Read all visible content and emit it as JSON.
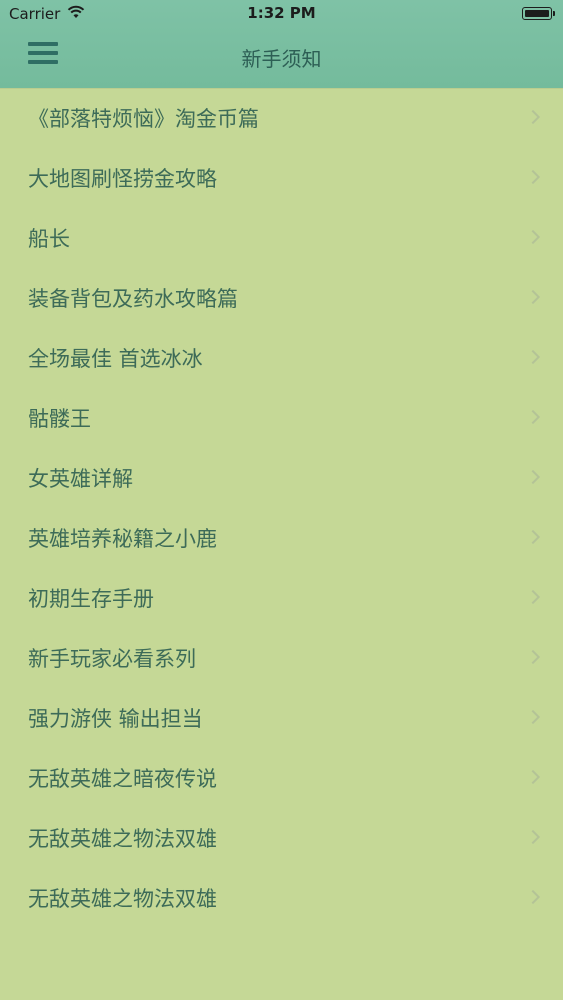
{
  "status_bar": {
    "carrier": "Carrier",
    "time": "1:32 PM",
    "wifi_icon": "wifi-icon",
    "battery_icon": "battery-icon"
  },
  "nav": {
    "title": "新手须知",
    "menu_icon": "hamburger-menu-icon"
  },
  "colors": {
    "nav_background": "#77be9f",
    "list_background": "#c5d896",
    "text": "#3d6b58",
    "nav_icon": "#2f6e64"
  },
  "items": [
    {
      "label": "《部落特烦恼》淘金币篇"
    },
    {
      "label": "大地图刷怪捞金攻略"
    },
    {
      "label": "船长"
    },
    {
      "label": "装备背包及药水攻略篇"
    },
    {
      "label": "全场最佳 首选冰冰"
    },
    {
      "label": "骷髅王"
    },
    {
      "label": "女英雄详解"
    },
    {
      "label": "英雄培养秘籍之小鹿"
    },
    {
      "label": "初期生存手册"
    },
    {
      "label": "新手玩家必看系列"
    },
    {
      "label": "强力游侠 输出担当"
    },
    {
      "label": "无敌英雄之暗夜传说"
    },
    {
      "label": "无敌英雄之物法双雄"
    },
    {
      "label": "无敌英雄之物法双雄"
    }
  ]
}
